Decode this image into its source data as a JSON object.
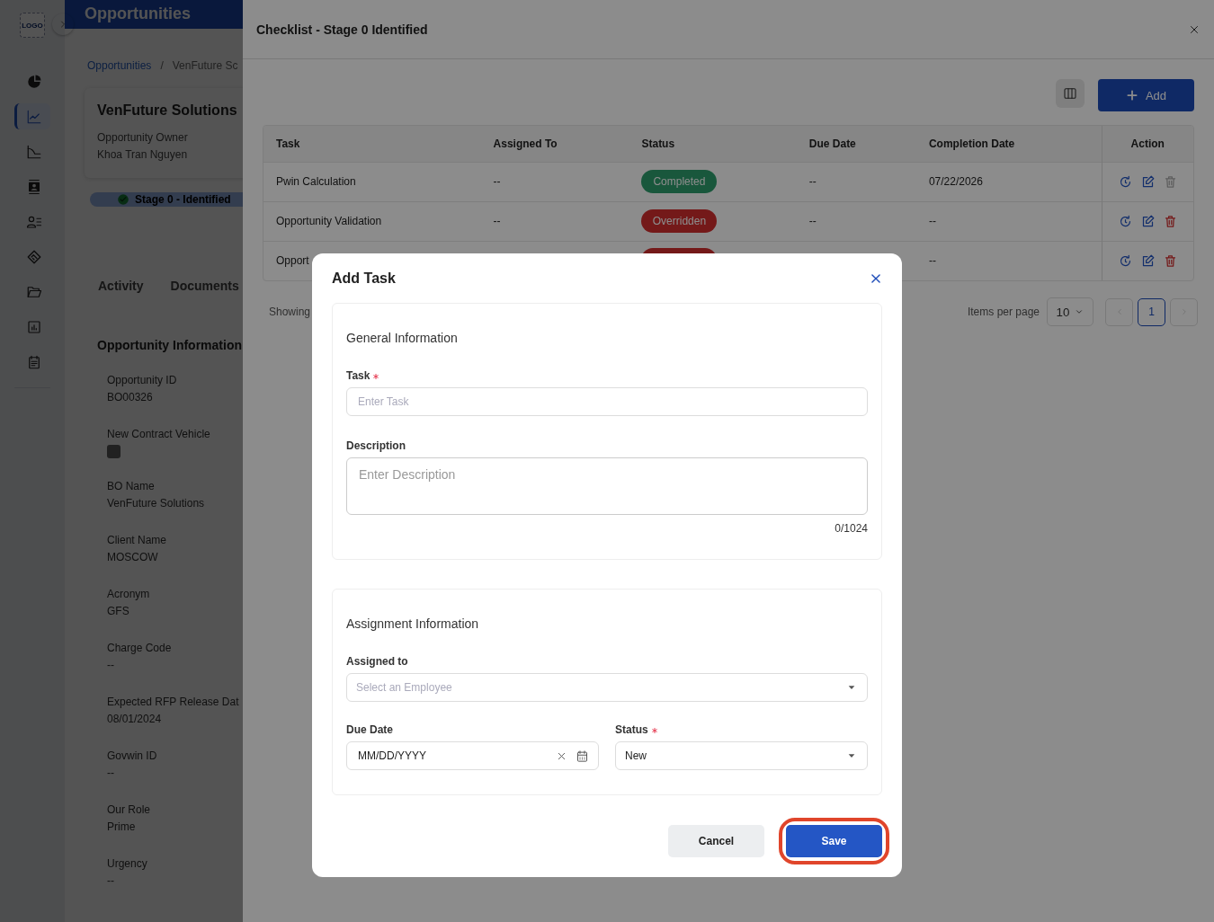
{
  "sidebar": {
    "logo": "LOGO",
    "items": [
      {
        "selected": false
      },
      {
        "selected": true
      },
      {
        "selected": false
      },
      {
        "selected": false
      },
      {
        "selected": false
      },
      {
        "selected": false
      },
      {
        "selected": false
      },
      {
        "selected": false
      },
      {
        "selected": false
      }
    ]
  },
  "page": {
    "title": "Opportunities",
    "breadcrumb": [
      {
        "label": "Opportunities",
        "kind": "link"
      },
      {
        "label": "/",
        "kind": "separator"
      },
      {
        "label": "VenFuture Sc",
        "kind": "current"
      }
    ],
    "card": {
      "name": "VenFuture Solutions",
      "owner_label": "Opportunity Owner",
      "owner": "Khoa Tran Nguyen"
    },
    "stage": "Stage 0 - Identified",
    "tabs": [
      {
        "label": "Activity",
        "selected": false
      },
      {
        "label": "Documents",
        "selected": false
      }
    ],
    "info": {
      "title": "Opportunity Information",
      "fields": [
        {
          "kind": "text",
          "label": "Opportunity ID",
          "value": "BO00326"
        },
        {
          "kind": "checkbox",
          "label": "New Contract Vehicle",
          "checked": false
        },
        {
          "kind": "text",
          "label": "BO Name",
          "value": "VenFuture Solutions"
        },
        {
          "kind": "text",
          "label": "Client Name",
          "value": "MOSCOW"
        },
        {
          "kind": "text",
          "label": "Acronym",
          "value": "GFS"
        },
        {
          "kind": "text",
          "label": "Charge Code",
          "value": "--"
        },
        {
          "kind": "text",
          "label": "Expected RFP Release Dat",
          "value": "08/01/2024"
        },
        {
          "kind": "text",
          "label": "Govwin ID",
          "value": "--"
        },
        {
          "kind": "text",
          "label": "Our Role",
          "value": "Prime"
        },
        {
          "kind": "text",
          "label": "Urgency",
          "value": "--"
        }
      ]
    }
  },
  "drawer": {
    "title": "Checklist - Stage 0 Identified",
    "add_label": "Add",
    "table": {
      "columns": [
        "Task",
        "Assigned To",
        "Status",
        "Due Date",
        "Completion Date",
        "Action"
      ],
      "rows": [
        {
          "task": "Pwin Calculation",
          "assigned": "--",
          "status": {
            "kind": "completed",
            "label": "Completed"
          },
          "due": "--",
          "completed": "07/22/2026",
          "delete_disabled": true
        },
        {
          "task": "Opportunity Validation",
          "assigned": "--",
          "status": {
            "kind": "overridden",
            "label": "Overridden"
          },
          "due": "--",
          "completed": "--",
          "delete_disabled": false
        },
        {
          "task": "Opport",
          "status": {
            "kind": "overridden"
          },
          "completed": "--",
          "delete_disabled": false
        }
      ]
    },
    "pagination": {
      "showing": "Showing",
      "per_page_label": "Items per page",
      "page_size": "10",
      "pages": [
        {
          "label": "1",
          "selected": true
        }
      ]
    }
  },
  "modal": {
    "title": "Add Task",
    "general": {
      "title": "General Information",
      "task": {
        "label": "Task",
        "required": true,
        "placeholder": "Enter Task"
      },
      "description": {
        "label": "Description",
        "placeholder": "Enter Description",
        "counter": "0/1024"
      }
    },
    "assignment": {
      "title": "Assignment Information",
      "assigned": {
        "label": "Assigned to",
        "placeholder": "Select an Employee"
      },
      "due": {
        "label": "Due Date",
        "value": "MM/DD/YYYY"
      },
      "status": {
        "label": "Status",
        "required": true,
        "value": "New"
      }
    },
    "buttons": [
      {
        "kind": "secondary",
        "label": "Cancel",
        "highlighted": false
      },
      {
        "kind": "primary",
        "label": "Save",
        "highlighted": true
      }
    ]
  }
}
